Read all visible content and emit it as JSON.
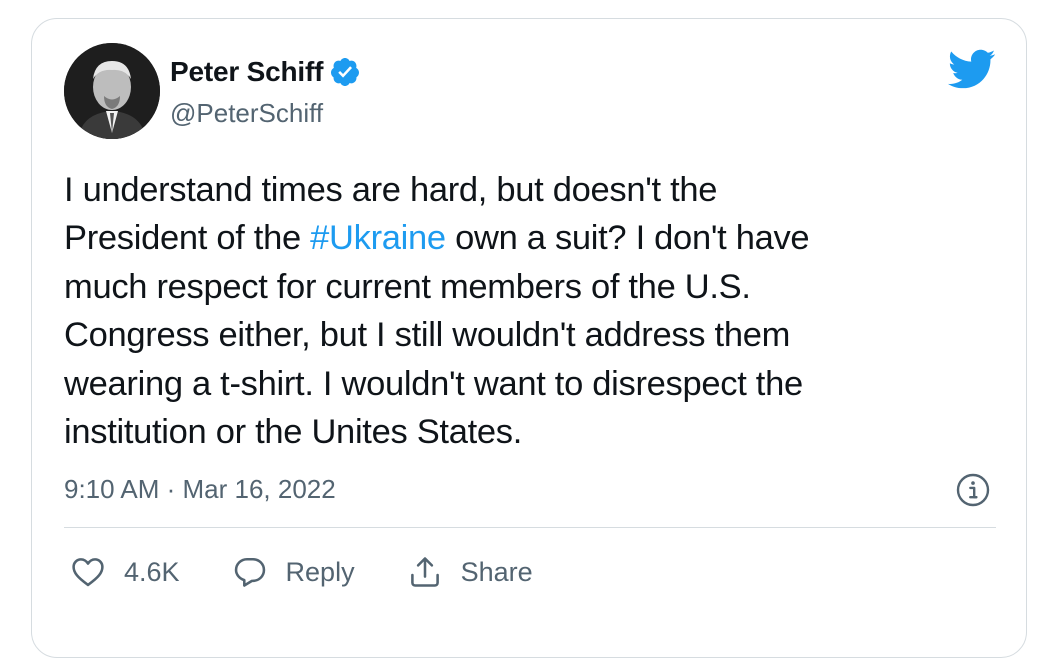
{
  "author": {
    "name": "Peter Schiff",
    "handle": "@PeterSchiff",
    "verified": true
  },
  "tweet": {
    "lines": [
      {
        "before": "I understand times are hard, but doesn't the",
        "hashtag": "",
        "after": ""
      },
      {
        "before": "President of the ",
        "hashtag": "#Ukraine",
        "after": " own a suit? I don't have"
      },
      {
        "before": "much respect for current members of the U.S.",
        "hashtag": "",
        "after": ""
      },
      {
        "before": "Congress either, but I still wouldn't address them",
        "hashtag": "",
        "after": ""
      },
      {
        "before": "wearing a t-shirt. I wouldn't want to disrespect the",
        "hashtag": "",
        "after": ""
      },
      {
        "before": "institution or the Unites States.",
        "hashtag": "",
        "after": ""
      }
    ],
    "timestamp": "9:10 AM · Mar 16, 2022"
  },
  "actions": {
    "like_count": "4.6K",
    "reply_label": "Reply",
    "share_label": "Share"
  },
  "icons": {
    "brand": "twitter-bird-icon",
    "verified": "verified-badge-icon",
    "info": "info-icon",
    "like": "heart-icon",
    "reply": "speech-bubble-icon",
    "share": "share-icon"
  },
  "colors": {
    "brand": "#1d9bf0",
    "text": "#0f1419",
    "secondary": "#536471",
    "border": "#d6dce0"
  }
}
